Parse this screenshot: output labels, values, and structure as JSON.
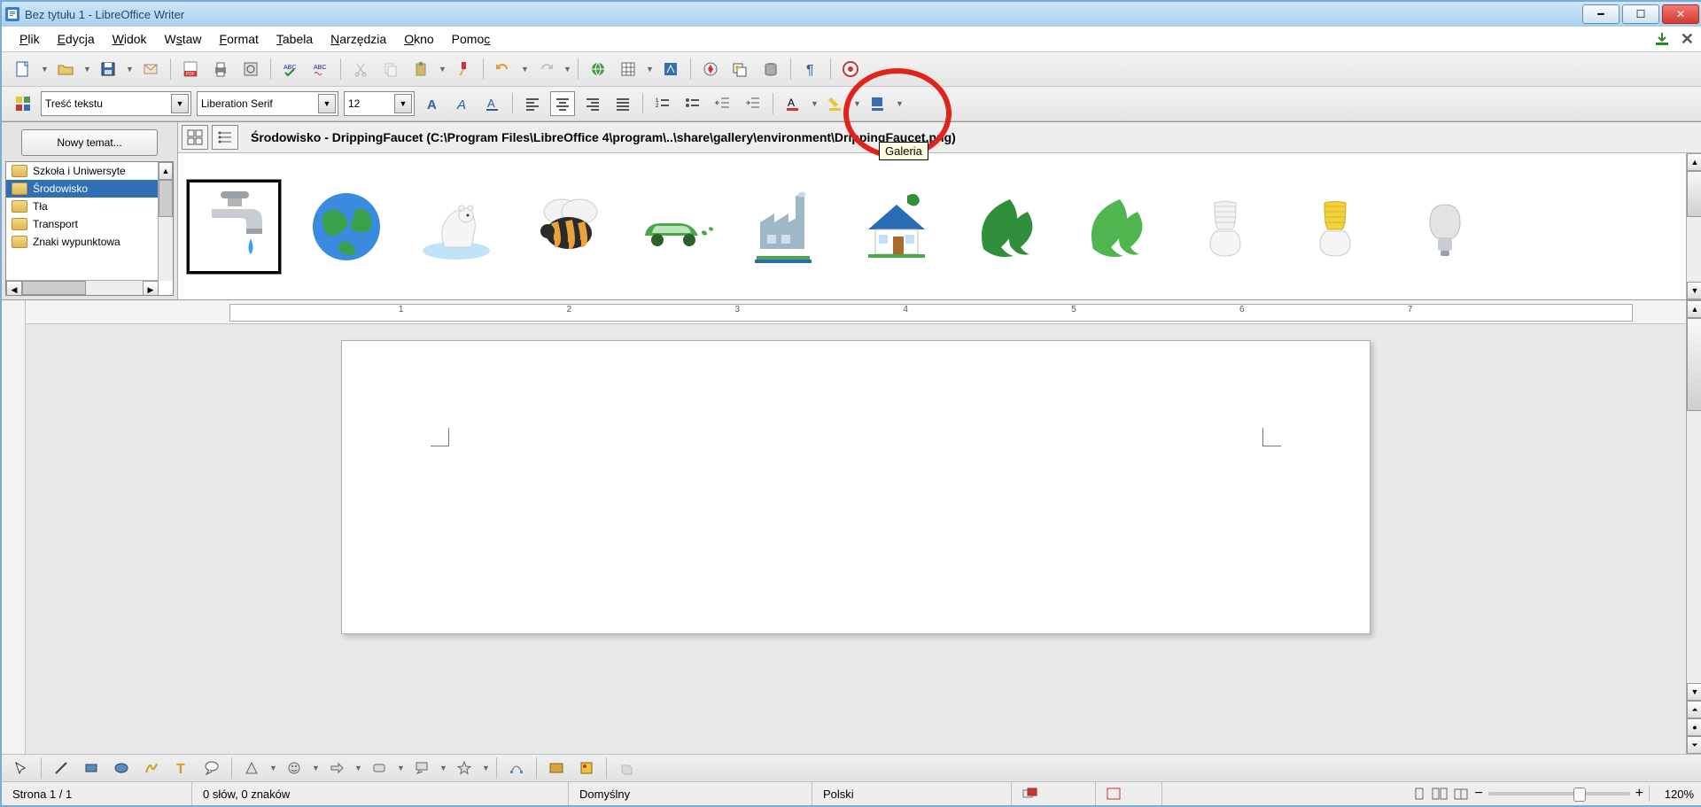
{
  "window": {
    "title": "Bez tytułu 1 - LibreOffice Writer"
  },
  "menu": {
    "items": [
      "Plik",
      "Edycja",
      "Widok",
      "Wstaw",
      "Format",
      "Tabela",
      "Narzędzia",
      "Okno",
      "Pomoc"
    ]
  },
  "format_toolbar": {
    "style": "Treść tekstu",
    "font": "Liberation Serif",
    "size": "12"
  },
  "tooltip": {
    "gallery": "Galeria"
  },
  "gallery": {
    "new_theme": "Nowy temat...",
    "themes": [
      "Szkoła i Uniwersyte",
      "Środowisko",
      "Tła",
      "Transport",
      "Znaki wypunktowa"
    ],
    "selected_index": 1,
    "path_label": "Środowisko - DrippingFaucet (C:\\Program Files\\LibreOffice 4\\program\\..\\share\\gallery\\environment\\DrippingFaucet.png)"
  },
  "ruler": {
    "marks": [
      "1",
      "2",
      "3",
      "4",
      "5",
      "6",
      "7"
    ]
  },
  "status": {
    "page": "Strona 1 / 1",
    "words": "0 słów, 0 znaków",
    "style": "Domyślny",
    "lang": "Polski",
    "zoom": "120%"
  }
}
